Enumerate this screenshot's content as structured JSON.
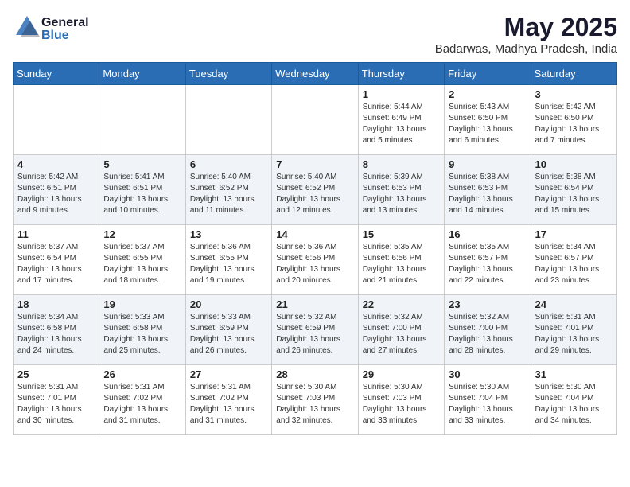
{
  "header": {
    "logo_general": "General",
    "logo_blue": "Blue",
    "month_title": "May 2025",
    "location": "Badarwas, Madhya Pradesh, India"
  },
  "weekdays": [
    "Sunday",
    "Monday",
    "Tuesday",
    "Wednesday",
    "Thursday",
    "Friday",
    "Saturday"
  ],
  "weeks": [
    [
      {
        "day": "",
        "info": ""
      },
      {
        "day": "",
        "info": ""
      },
      {
        "day": "",
        "info": ""
      },
      {
        "day": "",
        "info": ""
      },
      {
        "day": "1",
        "info": "Sunrise: 5:44 AM\nSunset: 6:49 PM\nDaylight: 13 hours\nand 5 minutes."
      },
      {
        "day": "2",
        "info": "Sunrise: 5:43 AM\nSunset: 6:50 PM\nDaylight: 13 hours\nand 6 minutes."
      },
      {
        "day": "3",
        "info": "Sunrise: 5:42 AM\nSunset: 6:50 PM\nDaylight: 13 hours\nand 7 minutes."
      }
    ],
    [
      {
        "day": "4",
        "info": "Sunrise: 5:42 AM\nSunset: 6:51 PM\nDaylight: 13 hours\nand 9 minutes."
      },
      {
        "day": "5",
        "info": "Sunrise: 5:41 AM\nSunset: 6:51 PM\nDaylight: 13 hours\nand 10 minutes."
      },
      {
        "day": "6",
        "info": "Sunrise: 5:40 AM\nSunset: 6:52 PM\nDaylight: 13 hours\nand 11 minutes."
      },
      {
        "day": "7",
        "info": "Sunrise: 5:40 AM\nSunset: 6:52 PM\nDaylight: 13 hours\nand 12 minutes."
      },
      {
        "day": "8",
        "info": "Sunrise: 5:39 AM\nSunset: 6:53 PM\nDaylight: 13 hours\nand 13 minutes."
      },
      {
        "day": "9",
        "info": "Sunrise: 5:38 AM\nSunset: 6:53 PM\nDaylight: 13 hours\nand 14 minutes."
      },
      {
        "day": "10",
        "info": "Sunrise: 5:38 AM\nSunset: 6:54 PM\nDaylight: 13 hours\nand 15 minutes."
      }
    ],
    [
      {
        "day": "11",
        "info": "Sunrise: 5:37 AM\nSunset: 6:54 PM\nDaylight: 13 hours\nand 17 minutes."
      },
      {
        "day": "12",
        "info": "Sunrise: 5:37 AM\nSunset: 6:55 PM\nDaylight: 13 hours\nand 18 minutes."
      },
      {
        "day": "13",
        "info": "Sunrise: 5:36 AM\nSunset: 6:55 PM\nDaylight: 13 hours\nand 19 minutes."
      },
      {
        "day": "14",
        "info": "Sunrise: 5:36 AM\nSunset: 6:56 PM\nDaylight: 13 hours\nand 20 minutes."
      },
      {
        "day": "15",
        "info": "Sunrise: 5:35 AM\nSunset: 6:56 PM\nDaylight: 13 hours\nand 21 minutes."
      },
      {
        "day": "16",
        "info": "Sunrise: 5:35 AM\nSunset: 6:57 PM\nDaylight: 13 hours\nand 22 minutes."
      },
      {
        "day": "17",
        "info": "Sunrise: 5:34 AM\nSunset: 6:57 PM\nDaylight: 13 hours\nand 23 minutes."
      }
    ],
    [
      {
        "day": "18",
        "info": "Sunrise: 5:34 AM\nSunset: 6:58 PM\nDaylight: 13 hours\nand 24 minutes."
      },
      {
        "day": "19",
        "info": "Sunrise: 5:33 AM\nSunset: 6:58 PM\nDaylight: 13 hours\nand 25 minutes."
      },
      {
        "day": "20",
        "info": "Sunrise: 5:33 AM\nSunset: 6:59 PM\nDaylight: 13 hours\nand 26 minutes."
      },
      {
        "day": "21",
        "info": "Sunrise: 5:32 AM\nSunset: 6:59 PM\nDaylight: 13 hours\nand 26 minutes."
      },
      {
        "day": "22",
        "info": "Sunrise: 5:32 AM\nSunset: 7:00 PM\nDaylight: 13 hours\nand 27 minutes."
      },
      {
        "day": "23",
        "info": "Sunrise: 5:32 AM\nSunset: 7:00 PM\nDaylight: 13 hours\nand 28 minutes."
      },
      {
        "day": "24",
        "info": "Sunrise: 5:31 AM\nSunset: 7:01 PM\nDaylight: 13 hours\nand 29 minutes."
      }
    ],
    [
      {
        "day": "25",
        "info": "Sunrise: 5:31 AM\nSunset: 7:01 PM\nDaylight: 13 hours\nand 30 minutes."
      },
      {
        "day": "26",
        "info": "Sunrise: 5:31 AM\nSunset: 7:02 PM\nDaylight: 13 hours\nand 31 minutes."
      },
      {
        "day": "27",
        "info": "Sunrise: 5:31 AM\nSunset: 7:02 PM\nDaylight: 13 hours\nand 31 minutes."
      },
      {
        "day": "28",
        "info": "Sunrise: 5:30 AM\nSunset: 7:03 PM\nDaylight: 13 hours\nand 32 minutes."
      },
      {
        "day": "29",
        "info": "Sunrise: 5:30 AM\nSunset: 7:03 PM\nDaylight: 13 hours\nand 33 minutes."
      },
      {
        "day": "30",
        "info": "Sunrise: 5:30 AM\nSunset: 7:04 PM\nDaylight: 13 hours\nand 33 minutes."
      },
      {
        "day": "31",
        "info": "Sunrise: 5:30 AM\nSunset: 7:04 PM\nDaylight: 13 hours\nand 34 minutes."
      }
    ]
  ]
}
